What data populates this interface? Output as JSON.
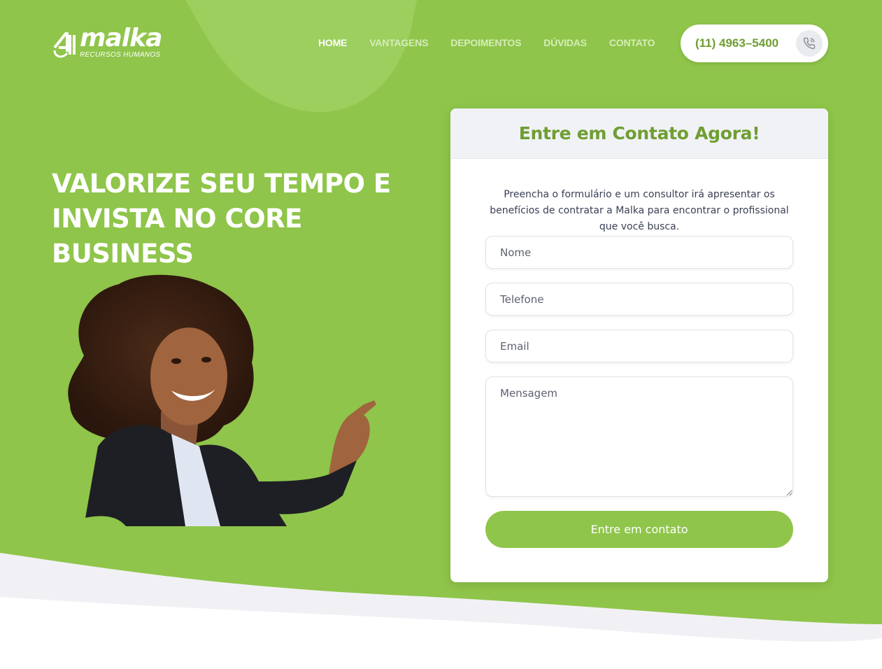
{
  "header": {
    "logo_word": "malka",
    "logo_subtitle": "RECURSOS HUMANOS",
    "nav": [
      {
        "label": "HOME",
        "active": true
      },
      {
        "label": "VANTAGENS",
        "active": false
      },
      {
        "label": "DEPOIMENTOS",
        "active": false
      },
      {
        "label": "DÚVIDAS",
        "active": false
      },
      {
        "label": "CONTATO",
        "active": false
      }
    ],
    "phone": "(11) 4963–5400",
    "phone_icon": "phone-call-icon"
  },
  "hero": {
    "title_line1": "VALORIZE SEU TEMPO E",
    "title_line2": "INVISTA NO CORE BUSINESS"
  },
  "form": {
    "title": "Entre em Contato Agora!",
    "description": "Preencha o formulário e um consultor irá apresentar os benefícios de contratar a Malka para encontrar o profissional que você busca.",
    "fields": {
      "name_placeholder": "Nome",
      "phone_placeholder": "Telefone",
      "email_placeholder": "Email",
      "message_placeholder": "Mensagem"
    },
    "submit_label": "Entre em contato"
  },
  "colors": {
    "brand_green": "#8fc54a",
    "brand_green_dark": "#6f9e32",
    "card_header_bg": "#f1f2f6",
    "text_dark": "#3a3f55"
  }
}
